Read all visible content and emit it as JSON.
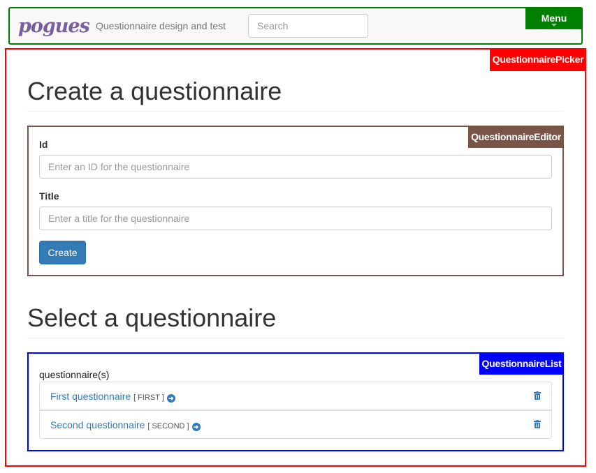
{
  "navbar": {
    "logo": "pogues",
    "tagline": "Questionnaire design and test",
    "search_placeholder": "Search",
    "menu_label": "Menu"
  },
  "picker": {
    "tag": "QuestionnairePicker",
    "create_heading": "Create a questionnaire",
    "editor": {
      "tag": "QuestionnaireEditor",
      "id_label": "Id",
      "id_placeholder": "Enter an ID for the questionnaire",
      "title_label": "Title",
      "title_placeholder": "Enter a title for the questionnaire",
      "create_label": "Create"
    },
    "select_heading": "Select a questionnaire",
    "list": {
      "tag": "QuestionnaireList",
      "caption": "questionnaire(s)",
      "items": [
        {
          "name": "First questionnaire",
          "id": "[ FIRST ]"
        },
        {
          "name": "Second questionnaire",
          "id": "[ SECOND ]"
        }
      ]
    }
  },
  "colors": {
    "navbar_border": "#008000",
    "picker": "#ff0000",
    "editor": "#795548",
    "list": "#0000ff",
    "primary": "#337ab7"
  }
}
